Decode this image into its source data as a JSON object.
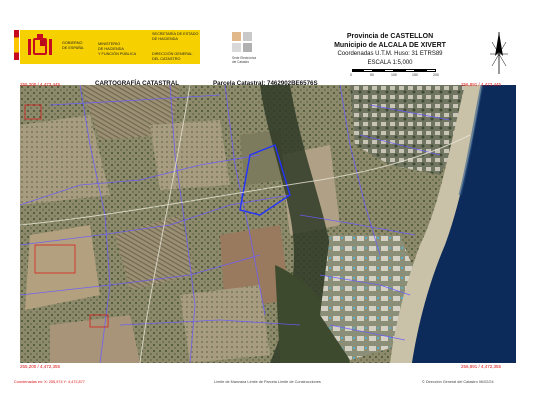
{
  "header": {
    "gov_left": [
      "GOBIERNO",
      "DE ESPAÑA"
    ],
    "gov_ministry": [
      "MINISTERIO",
      "DE HACIENDA",
      "Y FUNCIÓN PÚBLICA"
    ],
    "gov_secretaria": [
      "SECRETARÍA DE ESTADO",
      "DE HACIENDA"
    ],
    "gov_direccion": [
      "DIRECCIÓN GENERAL",
      "DEL CATASTRO"
    ],
    "catastro_label": [
      "Sede Electrónica",
      "del Catastro"
    ],
    "province": "Provincia de CASTELLON",
    "municipality": "Municipio de ALCALA DE XIVERT",
    "coordinates": "Coordenadas U.T.M. Huso: 31 ETRS89",
    "scale": "ESCALA 1:5,000",
    "scale_ticks": [
      "0",
      "50",
      "100",
      "150",
      "200"
    ]
  },
  "title": {
    "left": "CARTOGRAFÍA CATASTRAL",
    "right": "Parcela Catastral: 7462902BE6576S"
  },
  "corners": {
    "top_left": "255,200 / 4,473,445",
    "top_right": "256,891 / 4,473,445",
    "bottom_left": "255,200 / 4,472,355",
    "bottom_right": "256,891 / 4,472,355"
  },
  "footer": {
    "left": "Coordenadas en: X: 255,974 Y: 4,472,877",
    "center": "Límite de Manzana  Límite de Parcela  Límite de Construcciones",
    "right": "© Dirección General del Catastro 06/02/24"
  },
  "colors": {
    "parcel_line": "#6a5cff",
    "highlight": "#2233ff",
    "sea": "#0c2a5a",
    "red_mark": "#dd1111"
  }
}
